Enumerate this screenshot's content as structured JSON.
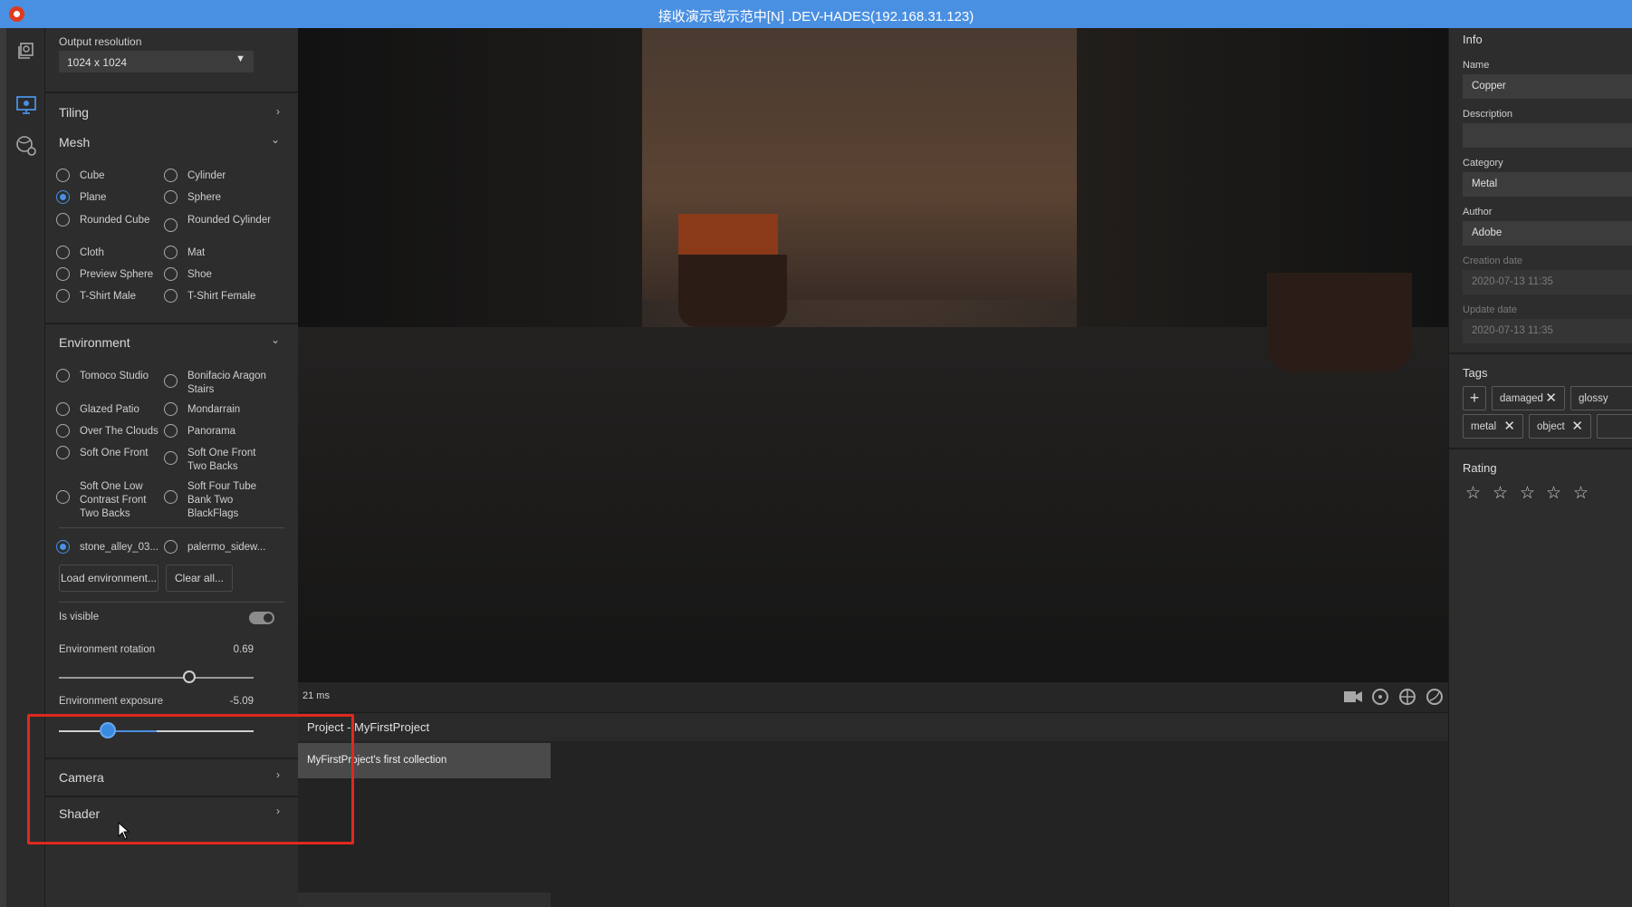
{
  "window": {
    "title": "接收演示或示范中[N] .DEV-HADES(192.168.31.123)"
  },
  "left_panel": {
    "output_resolution": {
      "label": "Output resolution",
      "value": "1024 x 1024"
    },
    "sections": {
      "tiling": "Tiling",
      "mesh": "Mesh",
      "environment": "Environment",
      "camera": "Camera",
      "shader": "Shader"
    },
    "mesh_options": [
      {
        "label": "Cube",
        "selected": false
      },
      {
        "label": "Cylinder",
        "selected": false
      },
      {
        "label": "Plane",
        "selected": true
      },
      {
        "label": "Sphere",
        "selected": false
      },
      {
        "label": "Rounded Cube",
        "selected": false
      },
      {
        "label": "Rounded Cylinder",
        "selected": false
      },
      {
        "label": "Cloth",
        "selected": false
      },
      {
        "label": "Mat",
        "selected": false
      },
      {
        "label": "Preview Sphere",
        "selected": false
      },
      {
        "label": "Shoe",
        "selected": false
      },
      {
        "label": "T-Shirt Male",
        "selected": false
      },
      {
        "label": "T-Shirt Female",
        "selected": false
      }
    ],
    "environment_options": [
      {
        "label": "Tomoco Studio",
        "selected": false
      },
      {
        "label": "Bonifacio Aragon Stairs",
        "selected": false
      },
      {
        "label": "Glazed Patio",
        "selected": false
      },
      {
        "label": "Mondarrain",
        "selected": false
      },
      {
        "label": "Over The Clouds",
        "selected": false
      },
      {
        "label": "Panorama",
        "selected": false
      },
      {
        "label": "Soft One Front",
        "selected": false
      },
      {
        "label": "Soft One Front Two Backs",
        "selected": false
      },
      {
        "label": "Soft One Low Contrast Front Two Backs",
        "selected": false
      },
      {
        "label": "Soft Four Tube Bank Two BlackFlags",
        "selected": false
      }
    ],
    "custom_environments": [
      {
        "label": "stone_alley_03...",
        "selected": true
      },
      {
        "label": "palermo_sidew...",
        "selected": false
      }
    ],
    "load_button": "Load environment...",
    "clear_button": "Clear all...",
    "is_visible": {
      "label": "Is visible",
      "on": true
    },
    "environment_rotation": {
      "label": "Environment rotation",
      "value": "0.69",
      "fraction": 0.67
    },
    "environment_exposure": {
      "label": "Environment exposure",
      "value": "-5.09",
      "fraction": 0.25,
      "fill_end_fraction": 0.5
    }
  },
  "viewport": {
    "frame_time": "21 ms",
    "icons": [
      "camera-icon",
      "rotate-icon",
      "grid-icon",
      "sphere-icon"
    ]
  },
  "project": {
    "title": "Project - MyFirstProject",
    "collection": "MyFirstProject's first collection"
  },
  "info_panel": {
    "title": "Info",
    "name": {
      "label": "Name",
      "value": "Copper"
    },
    "description": {
      "label": "Description",
      "value": ""
    },
    "category": {
      "label": "Category",
      "value": "Metal"
    },
    "author": {
      "label": "Author",
      "value": "Adobe"
    },
    "creation_date": {
      "label": "Creation date",
      "value": "2020-07-13 11:35"
    },
    "update_date": {
      "label": "Update date",
      "value": "2020-07-13 11:35"
    },
    "tags_title": "Tags",
    "add_tag": "+",
    "tags": [
      "damaged",
      "glossy",
      "metal",
      "object"
    ],
    "rating_title": "Rating",
    "rating": 0,
    "rating_max": 5
  },
  "colors": {
    "accent": "#4a90e2",
    "highlight": "#e0291f",
    "titlebar": "#4a90e2"
  }
}
